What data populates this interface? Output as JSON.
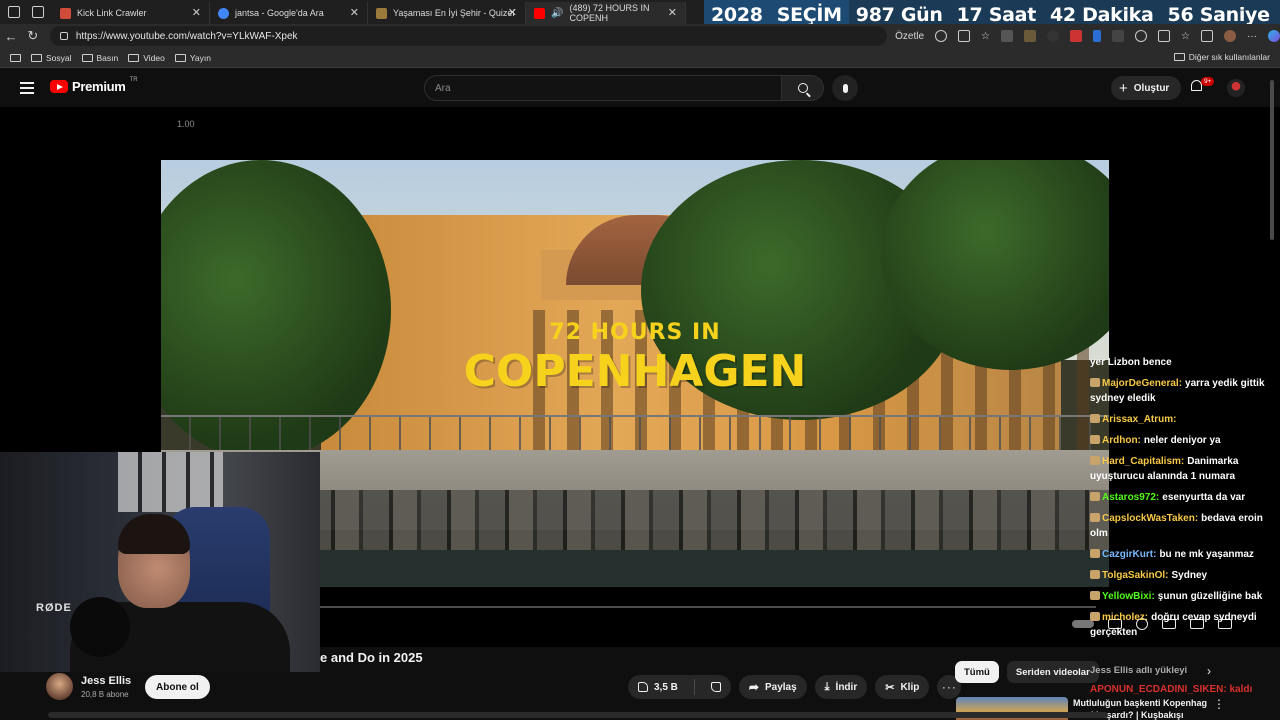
{
  "browser": {
    "tabs": [
      {
        "title": "Kick Link Crawler",
        "icon_color": "#d14b3a",
        "active": false
      },
      {
        "title": "jantsa - Google'da Ara",
        "icon_color": "#4285f4",
        "active": false
      },
      {
        "title": "Yaşaması En İyi Şehir - Quizei",
        "icon_color": "#9c7b3a",
        "active": false
      },
      {
        "title": "(489) 72 HOURS IN COPENH",
        "icon_color": "#ff0000",
        "active": true
      }
    ],
    "url": "https://www.youtube.com/watch?v=YLkWAF-Xpek",
    "summarize_label": "Özetle",
    "bookmarks": [
      "Sosyal",
      "Basın",
      "Video",
      "Yayın"
    ],
    "other_bookmarks": "Diğer sık kullanılanlar"
  },
  "countdown": {
    "year": "2028",
    "label": "SEÇİM",
    "days": "987 Gün",
    "hours": "17 Saat",
    "minutes": "42 Dakika",
    "seconds": "56 Saniye"
  },
  "youtube": {
    "logo_text": "Premium",
    "logo_region": "TR",
    "search_placeholder": "Ara",
    "create_label": "Oluştur",
    "notifications_badge": "9+"
  },
  "player": {
    "scale_label": "1.00",
    "overlay_title_top": "72 HOURS IN",
    "overlay_title_main": "COPENHAGEN"
  },
  "webcam": {
    "mic_brand": "RØDE"
  },
  "chat": {
    "messages": [
      {
        "user": "",
        "text": "yer Lizbon bence",
        "user_color": "#ffffff"
      },
      {
        "user": "MajorDeGeneral:",
        "text": "yarra yedik gittik sydney eledik",
        "user_color": "#f7c948"
      },
      {
        "user": "Arissax_Atrum:",
        "text": "",
        "user_color": "#f7c948"
      },
      {
        "user": "Ardhon:",
        "text": "neler deniyor ya",
        "user_color": "#f7c948"
      },
      {
        "user": "Hard_Capitalism:",
        "text": "Danimarka uyuşturucu alanında 1 numara",
        "user_color": "#f7c948"
      },
      {
        "user": "Astaros972:",
        "text": "esenyurtta da var",
        "user_color": "#53fc18"
      },
      {
        "user": "CapslockWasTaken:",
        "text": "bedava eroin olm",
        "user_color": "#f7c948"
      },
      {
        "user": "CazgirKurt:",
        "text": "bu ne mk yaşanmaz",
        "user_color": "#7ab8ff"
      },
      {
        "user": "TolgaSakinOl:",
        "text": "Sydney",
        "user_color": "#f7c948"
      },
      {
        "user": "YellowBixi:",
        "text": "şunun güzelliğine bak",
        "user_color": "#53fc18"
      },
      {
        "user": "micholez:",
        "text": "doğru cevap sydneydi gerçekten",
        "user_color": "#f7c948"
      }
    ],
    "overlap_line_1": "Jess Ellis adlı yükleyi",
    "overlap_line_2": "APONUN_ECDADINI_SIKEN: kaldı"
  },
  "video": {
    "title_visible": "e and Do in 2025",
    "channel_name": "Jess Ellis",
    "subscribers": "20,8 B abone",
    "subscribe_label": "Abone ol",
    "likes": "3,5 B",
    "share_label": "Paylaş",
    "download_label": "İndir",
    "clip_label": "Klip",
    "more_label": "···"
  },
  "sidebar": {
    "chips": [
      "Tümü",
      "Seriden videolar"
    ],
    "rec_title": "Mutluluğun başkenti Kopenhag nasıl başardı? | Kuşbakışı"
  },
  "colors": {
    "countdown_bg": "#1a3a55",
    "title_yellow": "#f6d21c",
    "yt_red": "#ff0000"
  }
}
